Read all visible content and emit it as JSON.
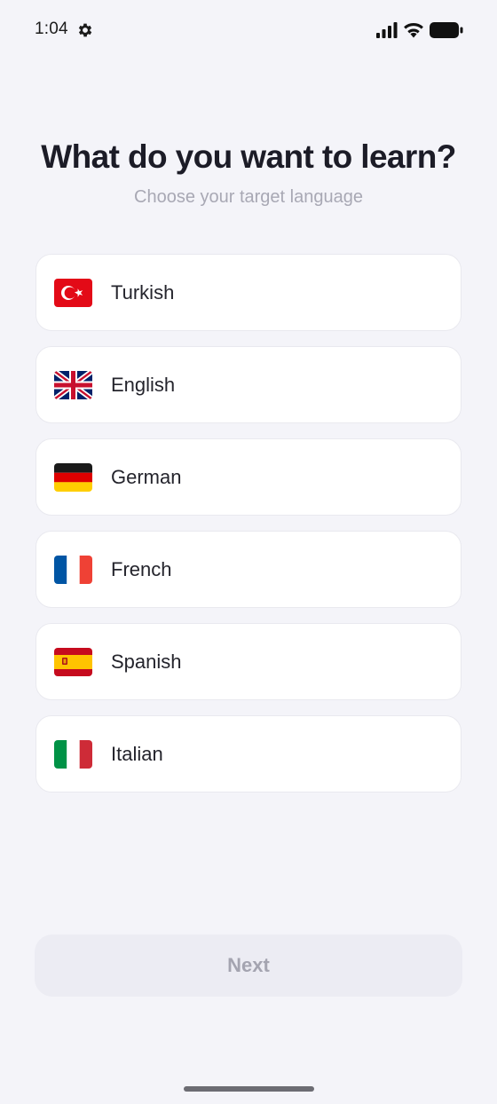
{
  "status_bar": {
    "time": "1:04",
    "icons": [
      "gear-icon",
      "signal-icon",
      "wifi-icon",
      "battery-icon"
    ]
  },
  "header": {
    "title": "What do you want to learn?",
    "subtitle": "Choose your target language"
  },
  "languages": [
    {
      "label": "Turkish",
      "flag": "turkey-flag-icon"
    },
    {
      "label": "English",
      "flag": "uk-flag-icon"
    },
    {
      "label": "German",
      "flag": "germany-flag-icon"
    },
    {
      "label": "French",
      "flag": "france-flag-icon"
    },
    {
      "label": "Spanish",
      "flag": "spain-flag-icon"
    },
    {
      "label": "Italian",
      "flag": "italy-flag-icon"
    }
  ],
  "footer": {
    "next_label": "Next"
  },
  "colors": {
    "background": "#f4f4f9",
    "card": "#ffffff",
    "card_border": "#e9e9ef",
    "title": "#1c1c27",
    "subtitle": "#a8a8b4",
    "button_disabled_bg": "#ececf3",
    "button_disabled_text": "#a4a4b0"
  }
}
